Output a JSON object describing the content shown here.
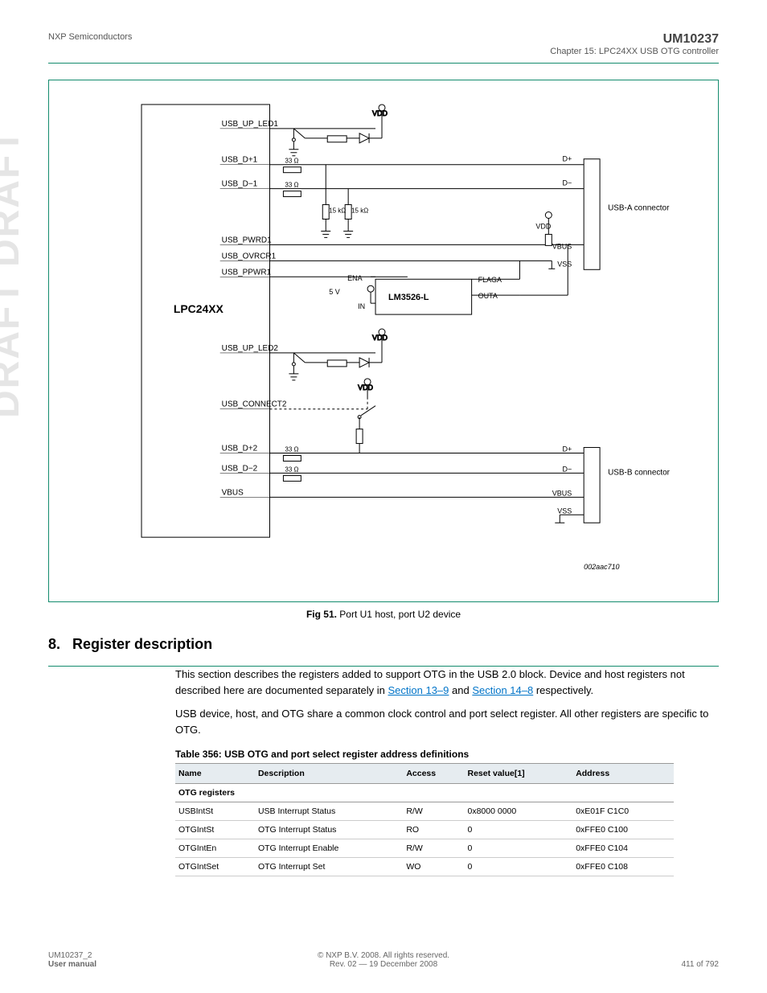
{
  "header": {
    "left": "NXP Semiconductors",
    "right_line1": "UM10237",
    "right_line2": "Chapter 15: LPC24XX USB OTG controller"
  },
  "watermark": "DRAFT   DRAFT",
  "diagram": {
    "lpc_label": "LPC24XX",
    "lm_label": "LM3526-L",
    "signals_left": [
      "USB_UP_LED1",
      "USB_D+1",
      "USB_D−1",
      "USB_PWRD1",
      "USB_OVRCR1",
      "USB_PPWR1",
      "USB_UP_LED2",
      "USB_CONNECT2",
      "USB_D+2",
      "USB_D−2",
      "VBUS"
    ],
    "res_33": "33 Ω",
    "res_15k": "15 kΩ",
    "vdd": "VDD",
    "vss": "VSS",
    "vbus": "VBUS",
    "five_v": "5 V",
    "in": "IN",
    "ena": "ENA",
    "flaga": "FLAGA",
    "outa": "OUTA",
    "dp": "D+",
    "dm": "D−",
    "conn_a": "USB-A connector",
    "conn_b": "USB-B connector",
    "fignum": "002aac710"
  },
  "figcap": {
    "num": "Fig 51.",
    "text": "Port U1 host, port U2 device"
  },
  "section": {
    "num": "8.",
    "title": "Register description"
  },
  "para": {
    "p1a": "This section describes the registers added to support OTG in the USB 2.0 block. Device and host registers not described here are documented separately in ",
    "link1": "Section 13–9",
    "p1b": " and ",
    "link2": "Section 14–8",
    "p1c": " respectively.",
    "p2": "USB device, host, and OTG share a common clock control and port select register. All other registers are specific to OTG."
  },
  "table": {
    "caption": "Table 356: USB OTG and port select register address definitions",
    "cols": [
      "Name",
      "Description",
      "Access",
      "Reset value[1]",
      "Address"
    ],
    "subhdr": "OTG registers",
    "rows": [
      [
        "USBIntSt",
        "USB Interrupt Status",
        "R/W",
        "0x8000 0000",
        "0xE01F C1C0"
      ],
      [
        "OTGIntSt",
        "OTG Interrupt Status",
        "RO",
        "0",
        "0xFFE0 C100"
      ],
      [
        "OTGIntEn",
        "OTG Interrupt Enable",
        "R/W",
        "0",
        "0xFFE0 C104"
      ],
      [
        "OTGIntSet",
        "OTG Interrupt Set",
        "WO",
        "0",
        "0xFFE0 C108"
      ]
    ]
  },
  "footer": {
    "l1": "UM10237_2",
    "l2": "User manual",
    "c1": "© NXP B.V. 2008. All rights reserved.",
    "c2": "Rev. 02 — 19 December 2008",
    "r2": "411 of 792"
  }
}
